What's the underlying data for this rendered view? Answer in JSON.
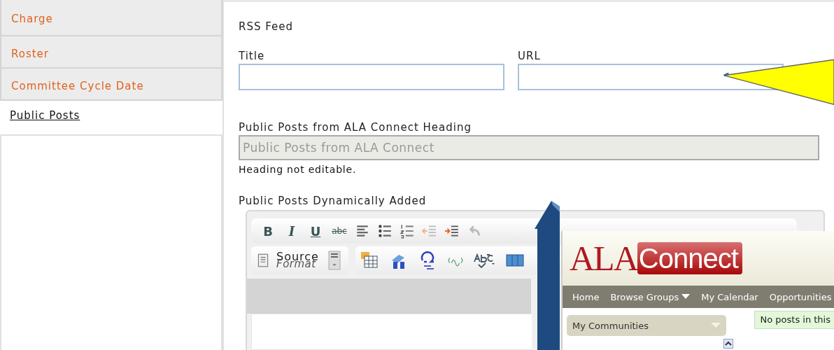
{
  "sidebar": {
    "items": [
      {
        "label": "Charge",
        "selected": false
      },
      {
        "label": "Roster",
        "selected": false
      },
      {
        "label": "Committee Cycle Date",
        "selected": false
      },
      {
        "label": "Public Posts",
        "selected": true
      }
    ]
  },
  "form": {
    "section_title": "RSS Feed",
    "title_field": {
      "label": "Title"
    },
    "url_field": {
      "label": "URL"
    },
    "heading_field": {
      "label": "Public Posts from ALA Connect Heading",
      "value": "Public Posts from ALA Connect",
      "disabled": true
    },
    "heading_note": "Heading not editable.",
    "editor_label": "Public Posts Dynamically Added",
    "toolbar_row_1": [
      {
        "kind": "bold",
        "label": "B"
      },
      {
        "kind": "italic",
        "label": "I"
      },
      {
        "kind": "underline",
        "label": "U"
      },
      {
        "kind": "strike",
        "label": "abc"
      },
      {
        "kind": "align"
      },
      {
        "kind": "bullets"
      },
      {
        "kind": "numbers"
      },
      {
        "kind": "outdent"
      },
      {
        "kind": "indent"
      },
      {
        "kind": "undo"
      }
    ],
    "toolbar_row_2": {
      "source": "Source",
      "format": "Format"
    }
  },
  "inset": {
    "logo_left": "ALA",
    "logo_right": "Connect",
    "nav": [
      {
        "label": "Home",
        "dropdown": false
      },
      {
        "label": "Browse Groups",
        "dropdown": true
      },
      {
        "label": "My Calendar",
        "dropdown": false
      },
      {
        "label": "Opportunities",
        "dropdown": false
      }
    ],
    "panel_title": "My Communities",
    "notice": "No posts in this"
  }
}
